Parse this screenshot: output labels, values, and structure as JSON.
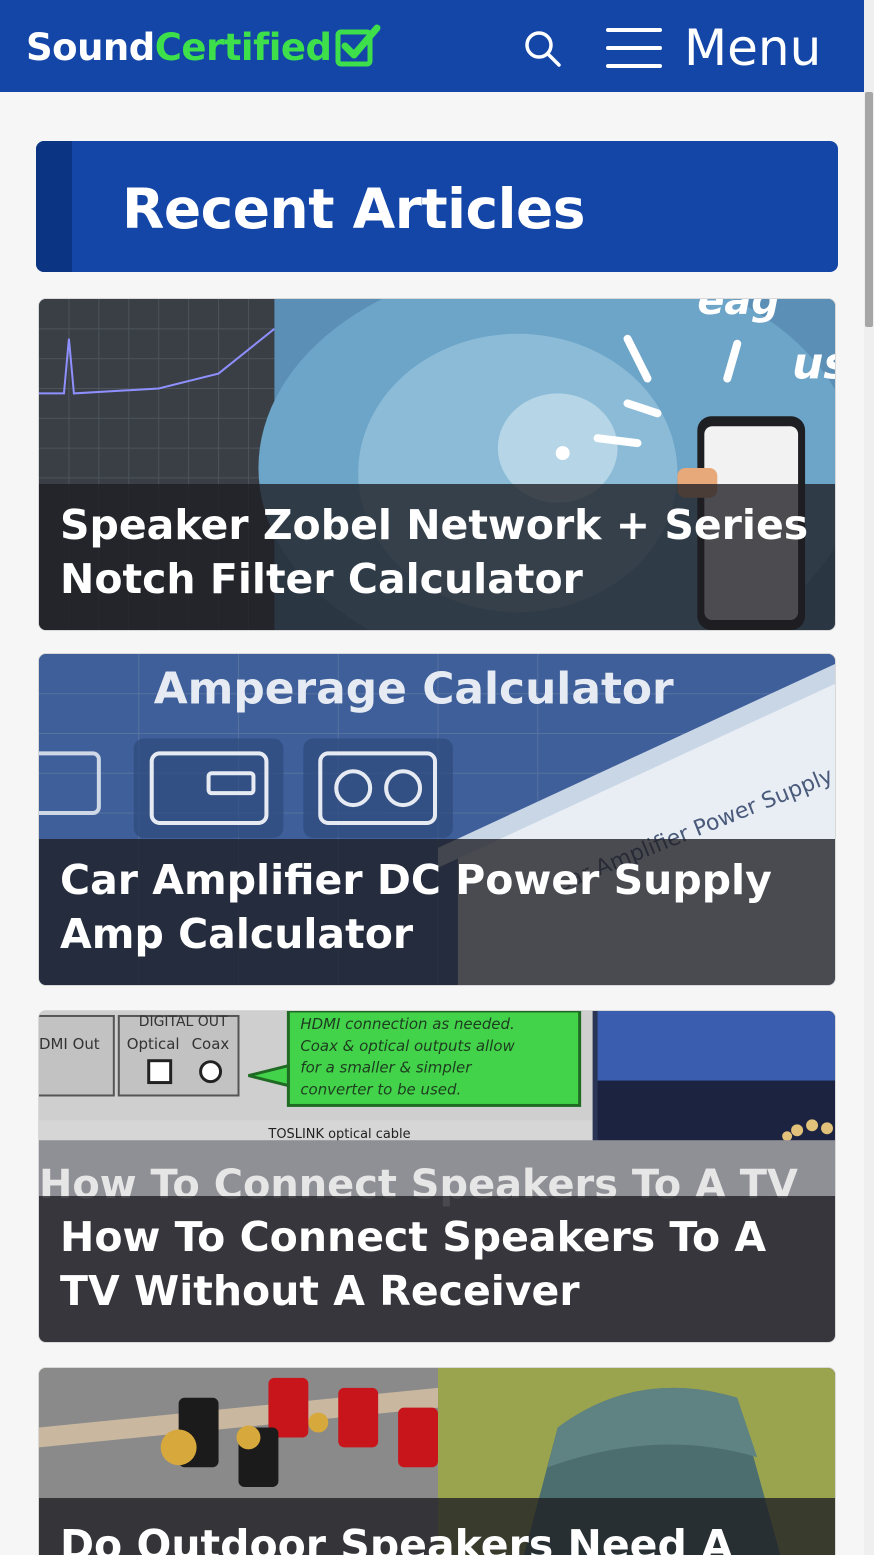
{
  "header": {
    "logo_part1": "Sound",
    "logo_part2": "Certified",
    "menu_label": "Menu"
  },
  "section": {
    "title": "Recent Articles"
  },
  "articles": [
    {
      "title": "Speaker Zobel Network + Series Notch Filter Calculator"
    },
    {
      "title": "Car Amplifier DC Power Supply Amp Calculator"
    },
    {
      "title": "How To Connect Speakers To A TV Without A Receiver"
    },
    {
      "title": "Do Outdoor Speakers Need A"
    }
  ],
  "thumbnails": [
    {
      "caption": ""
    },
    {
      "caption": "Amperage Calculator"
    },
    {
      "caption": "How To Connect Speakers To A TV"
    },
    {
      "caption": ""
    }
  ],
  "thumb_texts": {
    "t2_side": "Car Amplifier Power Supply Amperage Calculator",
    "t3_hdmi": "HDMI connection as needed. Coax & optical outputs allow for a smaller & simpler converter to be used.",
    "t3_digital": "DIGITAL OUT",
    "t3_optical": "Optical",
    "t3_coax": "Coax",
    "t3_hdmiout": "DMI Out",
    "t3_toslink": "TOSLINK optical cable"
  },
  "colors": {
    "brand_blue": "#1446a8",
    "brand_blue_dark": "#0b3583",
    "logo_green": "#3de04a"
  }
}
